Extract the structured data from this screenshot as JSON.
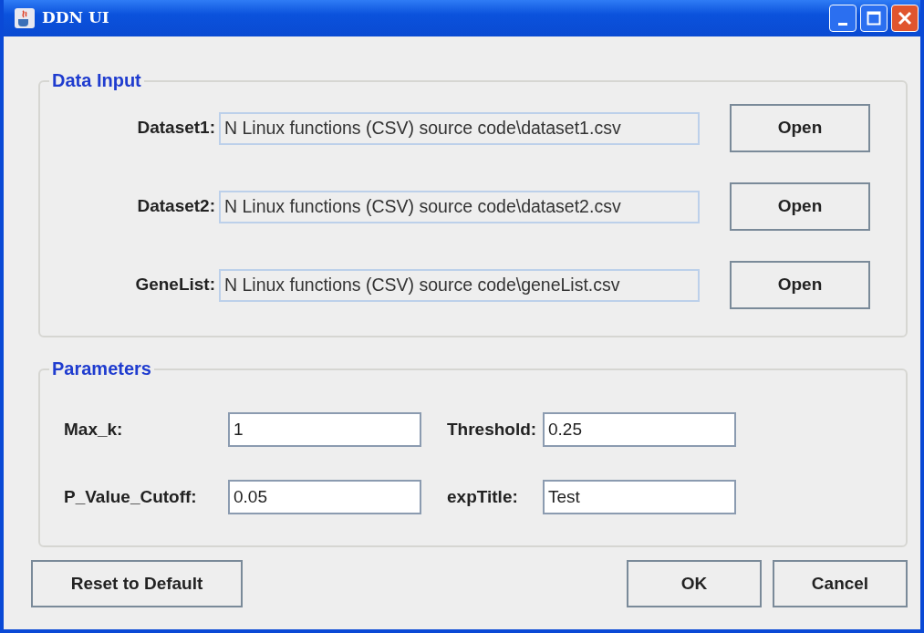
{
  "window": {
    "title": "DDN UI"
  },
  "data_input": {
    "title": "Data Input",
    "rows": [
      {
        "label": "Dataset1:",
        "value": "N Linux functions (CSV) source code\\dataset1.csv",
        "button": "Open"
      },
      {
        "label": "Dataset2:",
        "value": "N Linux functions (CSV) source code\\dataset2.csv",
        "button": "Open"
      },
      {
        "label": "GeneList:",
        "value": "N Linux functions (CSV) source code\\geneList.csv",
        "button": "Open"
      }
    ]
  },
  "parameters": {
    "title": "Parameters",
    "fields": [
      {
        "label": "Max_k:",
        "value": "1"
      },
      {
        "label": "Threshold:",
        "value": "0.25"
      },
      {
        "label": "P_Value_Cutoff:",
        "value": "0.05"
      },
      {
        "label": "expTitle:",
        "value": "Test"
      }
    ]
  },
  "buttons": {
    "left": [
      "Reset to Default"
    ],
    "right": [
      "OK",
      "Cancel"
    ]
  }
}
